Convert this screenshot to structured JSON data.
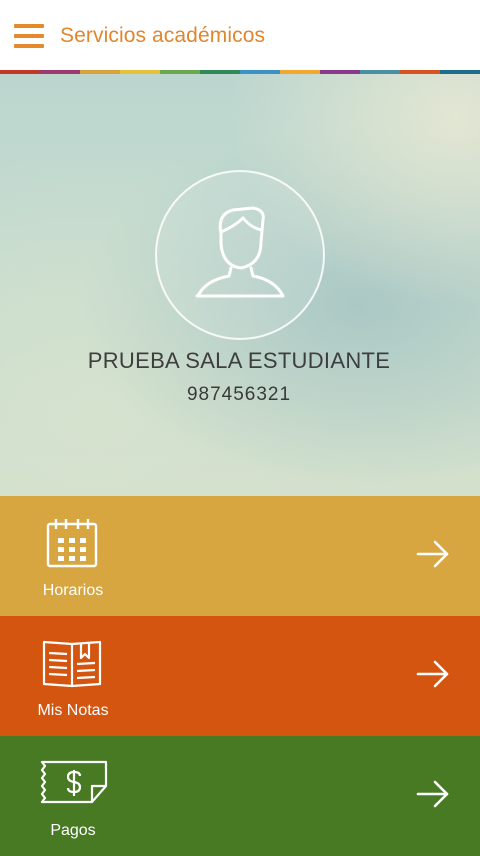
{
  "header": {
    "title": "Servicios académicos",
    "menu_icon": "hamburger-menu-icon",
    "accent": "#e48a2c"
  },
  "stripe_colors": [
    "#c0392b",
    "#9b3a6e",
    "#d9a23a",
    "#e8c13a",
    "#6aa84f",
    "#2e8b57",
    "#3c91c7",
    "#f0a830",
    "#8a3a8a",
    "#4a90a4",
    "#d9531e",
    "#1b6f8a"
  ],
  "profile": {
    "name": "PRUEBA SALA ESTUDIANTE",
    "id": "987456321",
    "avatar_icon": "user-avatar-icon"
  },
  "menu": [
    {
      "label": "Horarios",
      "icon": "calendar-icon",
      "color": "#d8a641"
    },
    {
      "label": "Mis Notas",
      "icon": "open-book-icon",
      "color": "#d3550f"
    },
    {
      "label": "Pagos",
      "icon": "payment-bill-icon",
      "color": "#477a23"
    }
  ]
}
